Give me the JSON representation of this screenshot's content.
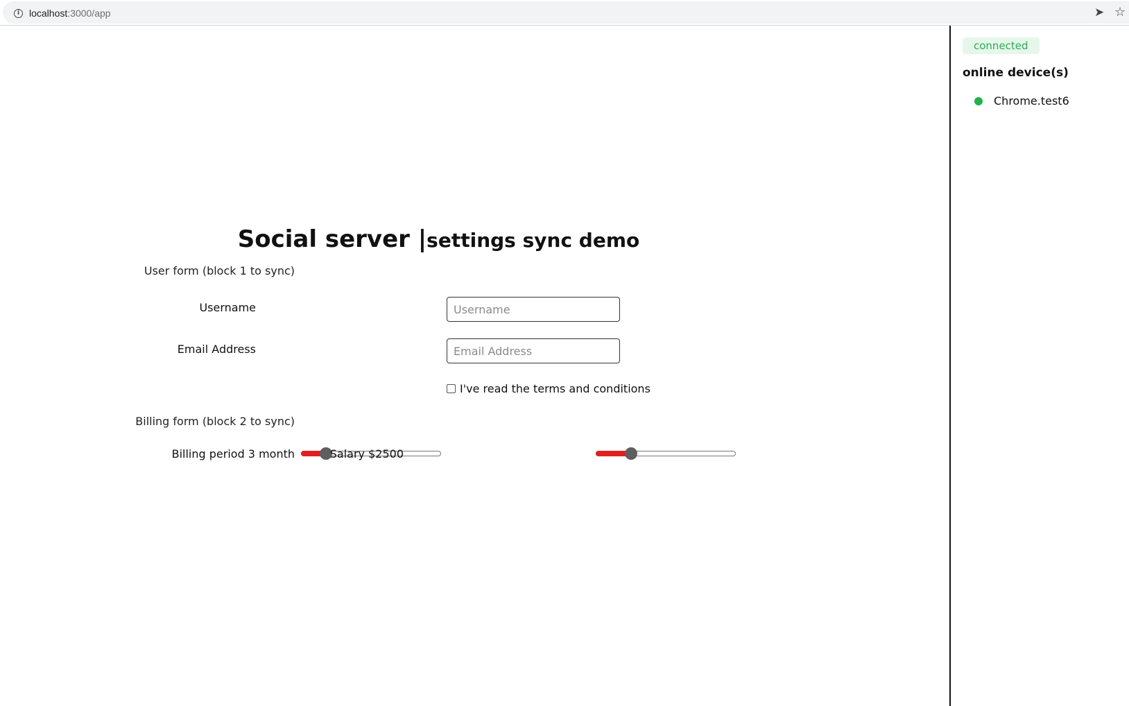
{
  "browser": {
    "url_host": "localhost",
    "url_path": ":3000/app",
    "info_icon": "info-icon",
    "send_icon": "send-icon",
    "bookmark_icon": "star-icon"
  },
  "main": {
    "title_main": "Social server ",
    "title_separator": "|",
    "title_sub": "settings sync demo",
    "user_form": {
      "label": "User form (block 1 to sync)",
      "username_label": "Username",
      "username_value": "",
      "username_placeholder": "Username",
      "email_label": "Email Address",
      "email_value": "",
      "email_placeholder": "Email Address",
      "terms_label": "I've read the terms and conditions",
      "terms_checked": false
    },
    "billing_form": {
      "label": "Billing form (block 2 to sync)",
      "billing_period_label": "Billing period 3 month",
      "billing_period_fraction": 0.18,
      "salary_label": "Salary $2500",
      "salary_fraction": 0.25
    }
  },
  "sidebar": {
    "status": "connected",
    "devices_title": "online device(s)",
    "devices": [
      {
        "name": "Chrome.test6",
        "status_color": "#22b14c"
      }
    ]
  },
  "colors": {
    "slider_fill": "#e02020",
    "slider_thumb": "#5e5e5e",
    "status_text": "#2eaa5a",
    "status_bg": "#e6f7ea",
    "online_dot": "#22b14c"
  }
}
